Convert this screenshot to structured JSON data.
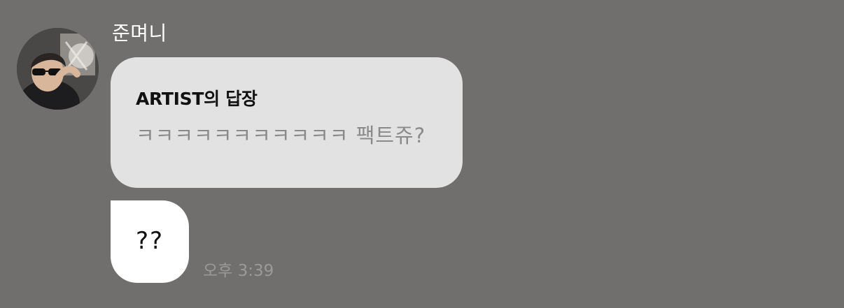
{
  "sender": {
    "name": "준며니",
    "avatar_icon": "profile-photo"
  },
  "reply": {
    "title": "ARTIST의 답장",
    "text": "ㅋㅋㅋㅋㅋㅋㅋㅋㅋㅋㅋ 팩트쥬?"
  },
  "message": {
    "text": "??",
    "time": "오후 3:39"
  },
  "colors": {
    "background": "#706f6e",
    "reply_bubble": "#e2e2e2",
    "message_bubble": "#ffffff",
    "reply_text": "#8a8a8a",
    "timestamp": "#9a9a9a"
  }
}
